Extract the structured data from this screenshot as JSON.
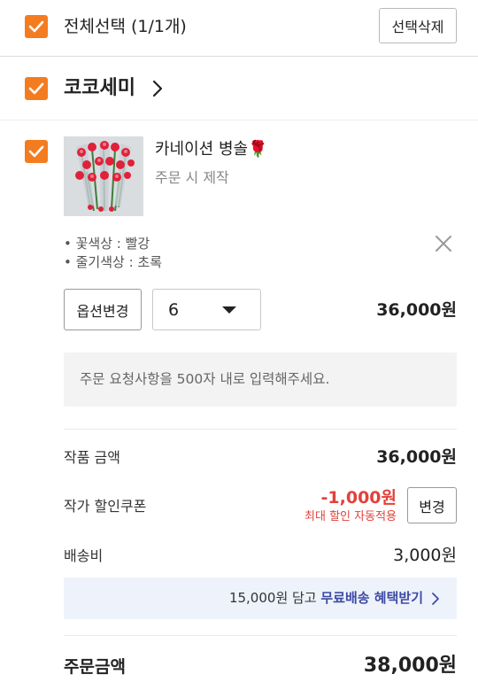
{
  "header": {
    "select_all_label": "전체선택 (1/1개)",
    "delete_selected_label": "선택삭제"
  },
  "shop": {
    "name": "코코세미"
  },
  "item": {
    "title": "카네이션 병솔🌹",
    "subtitle": "주문 시 제작",
    "options": [
      "• 꽃색상 : 빨강",
      "• 줄기색상 : 초록"
    ],
    "change_option_label": "옵션변경",
    "quantity": "6",
    "price": "36,000원",
    "request_placeholder": "주문 요청사항을 500자 내로 입력해주세요."
  },
  "summary": {
    "product_amount_label": "작품 금액",
    "product_amount_value": "36,000원",
    "coupon_label": "작가 할인쿠폰",
    "coupon_value": "-1,000원",
    "coupon_note": "최대 할인 자동적용",
    "coupon_change_label": "변경",
    "shipping_label": "배송비",
    "shipping_value": "3,000원",
    "free_shipping_prefix": "15,000원 담고 ",
    "free_shipping_link": "무료배송 혜택받기",
    "order_total_label": "주문금액",
    "order_total_value": "38,000원"
  },
  "colors": {
    "accent": "#f47c20",
    "discount": "#e4403a",
    "link": "#3d4ba3",
    "banner_bg": "#eef2fb"
  }
}
